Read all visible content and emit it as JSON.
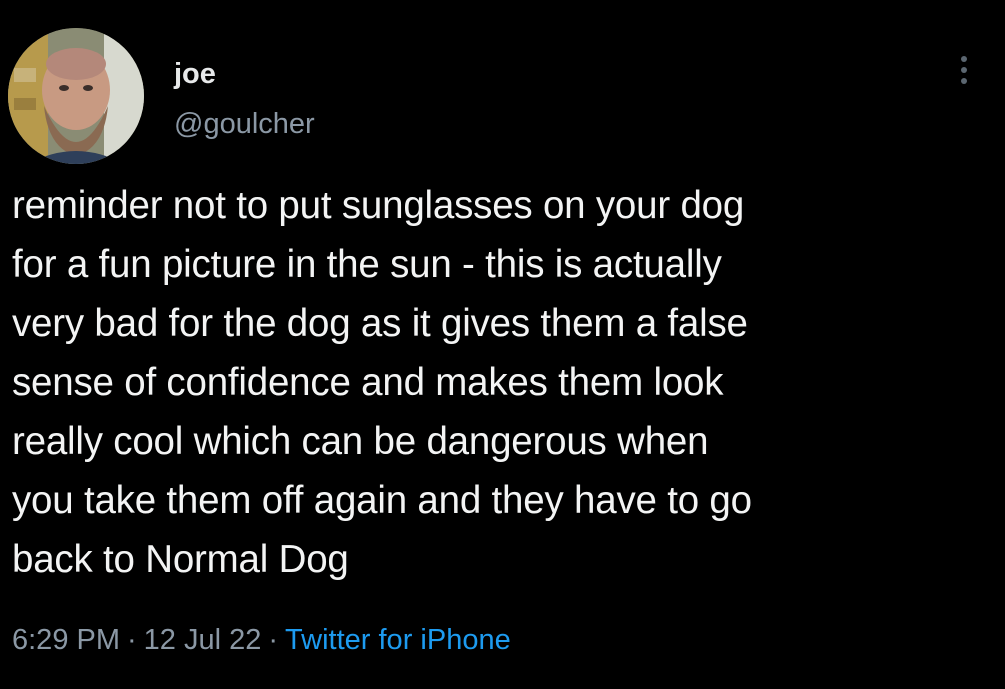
{
  "user": {
    "display_name": "joe",
    "handle": "@goulcher"
  },
  "tweet": {
    "lines": [
      "reminder not to put sunglasses on your dog",
      "for a fun picture in the sun - this is actually",
      "very bad for the dog as it gives them a false",
      "sense of confidence and makes them look",
      "really cool which can be dangerous when",
      "you take them off again and they have to go",
      "back to Normal Dog"
    ],
    "time": "6:29 PM",
    "date": "12 Jul 22",
    "separator": "·",
    "source": "Twitter for iPhone"
  },
  "icons": {
    "more": "more-options-icon",
    "avatar": "profile-photo"
  },
  "colors": {
    "background": "#000000",
    "text": "#e7e9ea",
    "secondary_text": "#8b98a5",
    "link": "#1d9bf0"
  }
}
